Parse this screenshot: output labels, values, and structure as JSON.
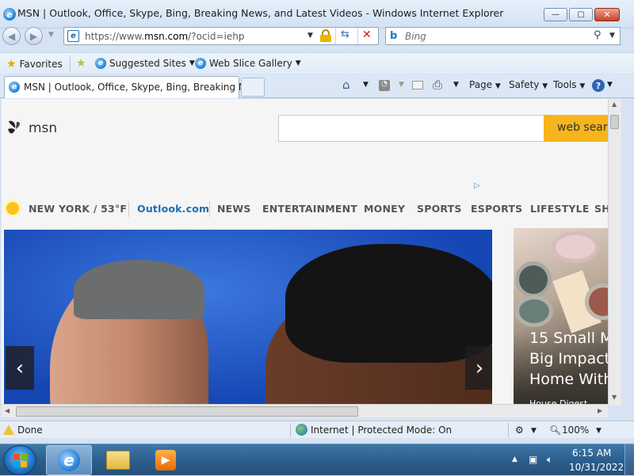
{
  "window": {
    "title": "MSN | Outlook, Office, Skype, Bing, Breaking News, and Latest Videos - Windows Internet Explorer",
    "minimize": "—",
    "maximize": "▢",
    "close": "✕"
  },
  "navigation": {
    "address_prefix": "https://www.",
    "address_domain": "msn.com",
    "address_suffix": "/?ocid=iehp",
    "search_placeholder": "Bing"
  },
  "favorites_bar": {
    "favorites_label": "Favorites",
    "suggested_sites": "Suggested Sites",
    "web_slice_gallery": "Web Slice Gallery"
  },
  "tabs": {
    "active_tab_title": "MSN | Outlook, Office, Skype, Bing, Breaking Ne..."
  },
  "command_bar": {
    "page": "Page",
    "safety": "Safety",
    "tools": "Tools",
    "help": "?"
  },
  "page": {
    "logo_text": "msn",
    "search_button": "web search",
    "weather": "NEW YORK / 53°F",
    "nav_items": [
      "Outlook.com",
      "NEWS",
      "ENTERTAINMENT",
      "MONEY",
      "SPORTS",
      "ESPORTS",
      "LIFESTYLE",
      "SH"
    ],
    "card_title": "15 Small M\nBig Impact\nHome With",
    "card_source": "House Digest"
  },
  "status_bar": {
    "status": "Done",
    "zone": "Internet | Protected Mode: On",
    "zoom": "100%"
  },
  "taskbar": {
    "time": "6:15 AM",
    "date": "10/31/2022"
  }
}
